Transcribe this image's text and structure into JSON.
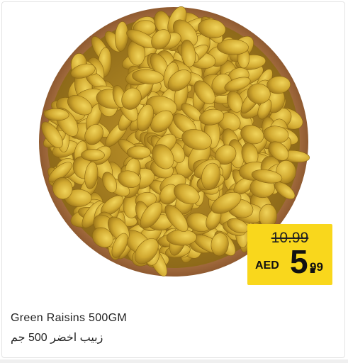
{
  "product": {
    "name_en": "Green Raisins  500GM",
    "name_ar": "زبيب اخضر 500 جم"
  },
  "price": {
    "old": "10.99",
    "currency": "AED",
    "integer": "5.",
    "decimal": "99"
  },
  "colors": {
    "price_box": "#f9d71c",
    "bowl_rim": "#b07a4a",
    "raisin": "#d8b33a"
  },
  "image": {
    "subject": "raisins-bowl-icon"
  }
}
